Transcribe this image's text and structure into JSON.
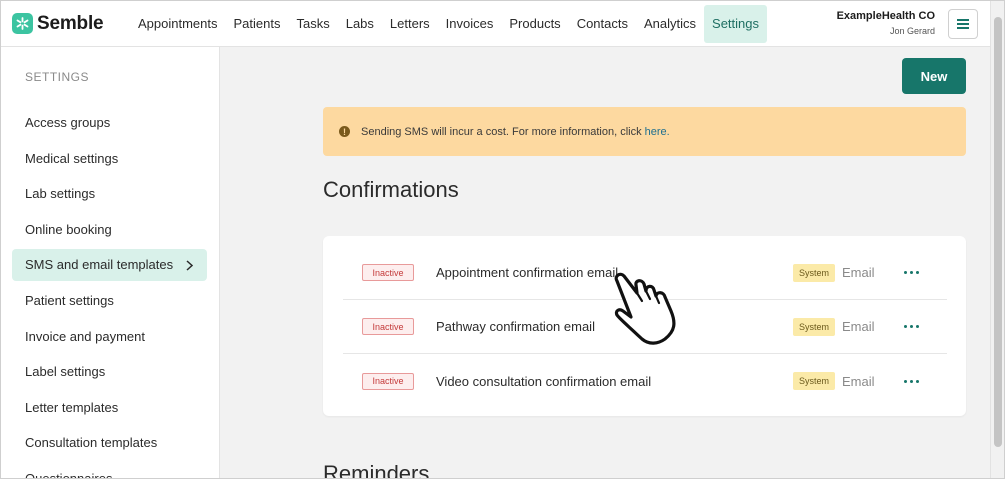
{
  "app": {
    "brand": "Semble",
    "colors": {
      "accent": "#17766a",
      "brand_mark": "#3cc4a1",
      "active_bg": "#d9f1ea",
      "alert_bg": "#fdd9a0"
    }
  },
  "nav": {
    "items": [
      {
        "label": "Appointments"
      },
      {
        "label": "Patients"
      },
      {
        "label": "Tasks"
      },
      {
        "label": "Labs"
      },
      {
        "label": "Letters"
      },
      {
        "label": "Invoices"
      },
      {
        "label": "Products"
      },
      {
        "label": "Contacts"
      },
      {
        "label": "Analytics"
      },
      {
        "label": "Settings",
        "active": true
      }
    ]
  },
  "account": {
    "org": "ExampleHealth CO",
    "user": "Jon Gerard",
    "menu_icon": "hamburger-icon"
  },
  "sidebar": {
    "heading": "SETTINGS",
    "items": [
      {
        "label": "Access groups"
      },
      {
        "label": "Medical settings"
      },
      {
        "label": "Lab settings"
      },
      {
        "label": "Online booking"
      },
      {
        "label": "SMS and email templates",
        "active": true,
        "icon": "chevron-right-icon"
      },
      {
        "label": "Patient settings"
      },
      {
        "label": "Invoice and payment"
      },
      {
        "label": "Label settings"
      },
      {
        "label": "Letter templates"
      },
      {
        "label": "Consultation templates"
      },
      {
        "label": "Questionnaires"
      }
    ]
  },
  "main": {
    "new_button": "New",
    "alert": {
      "icon": "info-icon",
      "text": "Sending SMS will incur a cost. For more information, click",
      "link": "here."
    },
    "confirmations": {
      "title": "Confirmations",
      "rows": [
        {
          "status": "Inactive",
          "name": "Appointment confirmation email",
          "badge": "System",
          "channel": "Email",
          "action_icon": "more-options-icon"
        },
        {
          "status": "Inactive",
          "name": "Pathway confirmation email",
          "badge": "System",
          "channel": "Email",
          "action_icon": "more-options-icon"
        },
        {
          "status": "Inactive",
          "name": "Video consultation confirmation email",
          "badge": "System",
          "channel": "Email",
          "action_icon": "more-options-icon"
        }
      ]
    },
    "reminders": {
      "title": "Reminders"
    }
  },
  "cursor": {
    "icon": "hand-pointer-icon"
  }
}
